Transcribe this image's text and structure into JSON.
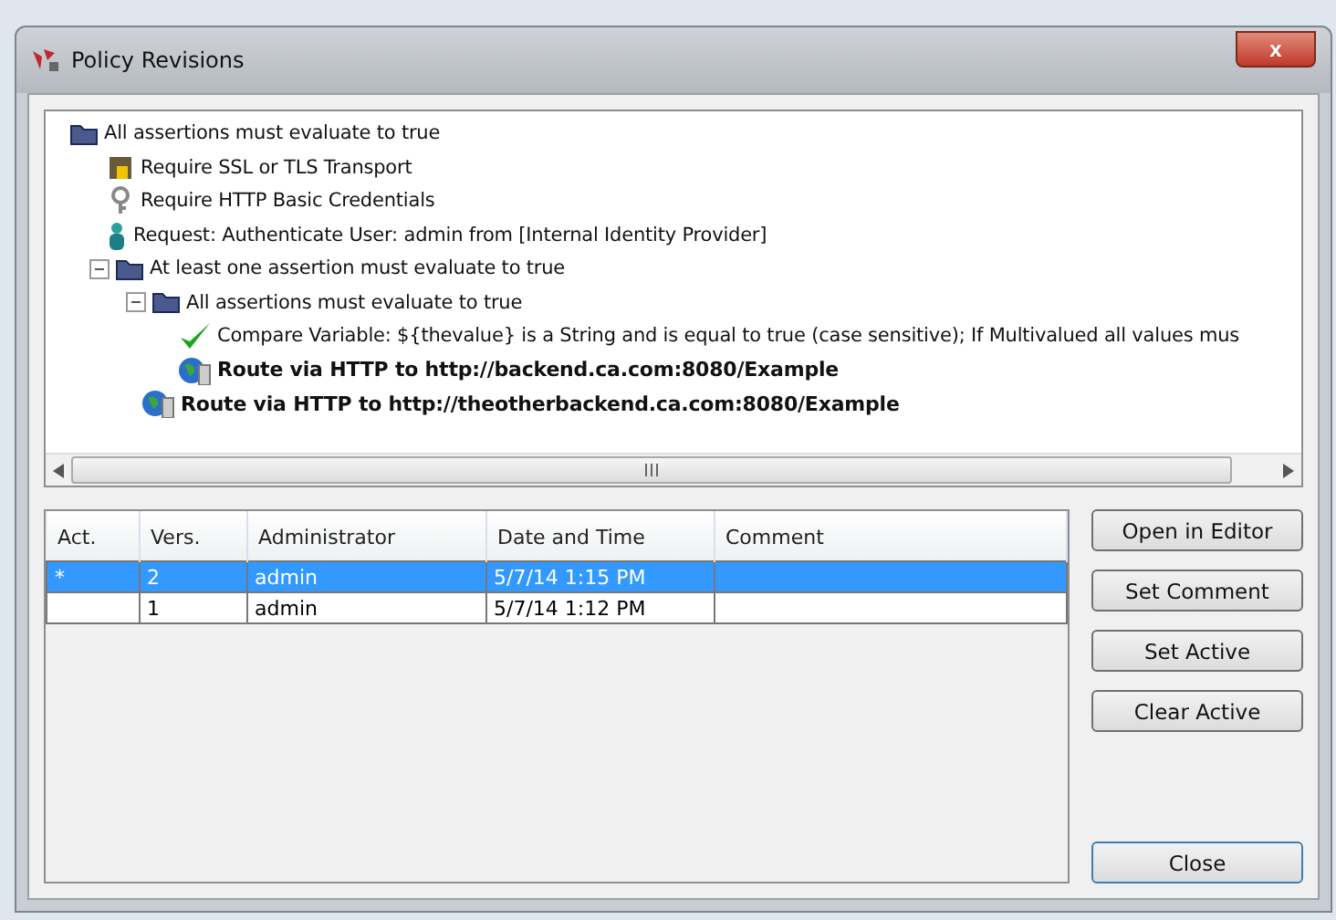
{
  "window": {
    "title": "Policy Revisions",
    "close": "x"
  },
  "tree": {
    "items": [
      {
        "kind": "folder",
        "label": "All assertions must evaluate to true",
        "children": [
          {
            "kind": "lock",
            "label": "Require SSL or TLS Transport"
          },
          {
            "kind": "credentials",
            "label": "Require HTTP Basic Credentials"
          },
          {
            "kind": "user",
            "label": "Request: Authenticate User: admin from [Internal Identity Provider]"
          },
          {
            "kind": "folder",
            "label": "At least one assertion must evaluate to true",
            "expanded": true,
            "children": [
              {
                "kind": "folder",
                "label": "All assertions must evaluate to true",
                "expanded": true,
                "children": [
                  {
                    "kind": "check",
                    "label": "Compare Variable: ${thevalue} is a String and is equal to true (case sensitive); If Multivalued all values mus"
                  },
                  {
                    "kind": "route",
                    "label": "Route via HTTP to http://backend.ca.com:8080/Example"
                  }
                ]
              },
              {
                "kind": "route",
                "label": "Route via HTTP to http://theotherbackend.ca.com:8080/Example"
              }
            ]
          }
        ]
      }
    ]
  },
  "table": {
    "columns": [
      "Act.",
      "Vers.",
      "Administrator",
      "Date and Time",
      "Comment"
    ],
    "rows": [
      {
        "cells": [
          "*",
          "2",
          "admin",
          "5/7/14 1:15 PM",
          ""
        ],
        "selected": true
      },
      {
        "cells": [
          "",
          "1",
          "admin",
          "5/7/14 1:12 PM",
          ""
        ],
        "selected": false
      }
    ]
  },
  "buttons": [
    "Open in Editor",
    "Set Comment",
    "Set Active",
    "Clear Active"
  ],
  "close_button": "Close"
}
